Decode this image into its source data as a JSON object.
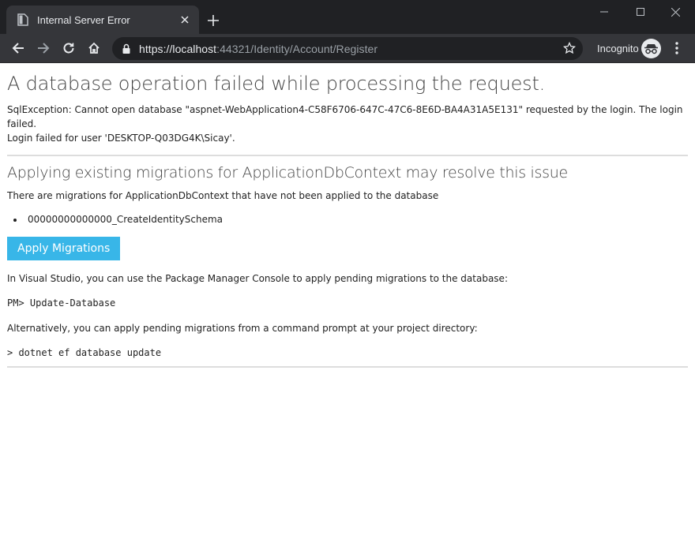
{
  "browser": {
    "tab_title": "Internal Server Error",
    "url_host": "https://localhost",
    "url_rest": ":44321/Identity/Account/Register",
    "incognito_label": "Incognito"
  },
  "page": {
    "heading": "A database operation failed while processing the request.",
    "error_line1": "SqlException: Cannot open database \"aspnet-WebApplication4-C58F6706-647C-47C6-8E6D-BA4A31A5E131\" requested by the login. The login failed.",
    "error_line2": "Login failed for user 'DESKTOP-Q03DG4K\\Sicay'.",
    "subheading": "Applying existing migrations for ApplicationDbContext may resolve this issue",
    "pending_text": "There are migrations for ApplicationDbContext that have not been applied to the database",
    "migrations": [
      "00000000000000_CreateIdentitySchema"
    ],
    "apply_button": "Apply Migrations",
    "vs_text": "In Visual Studio, you can use the Package Manager Console to apply pending migrations to the database:",
    "pm_command": "PM> Update-Database",
    "alt_text": "Alternatively, you can apply pending migrations from a command prompt at your project directory:",
    "cli_command": "> dotnet ef database update"
  }
}
